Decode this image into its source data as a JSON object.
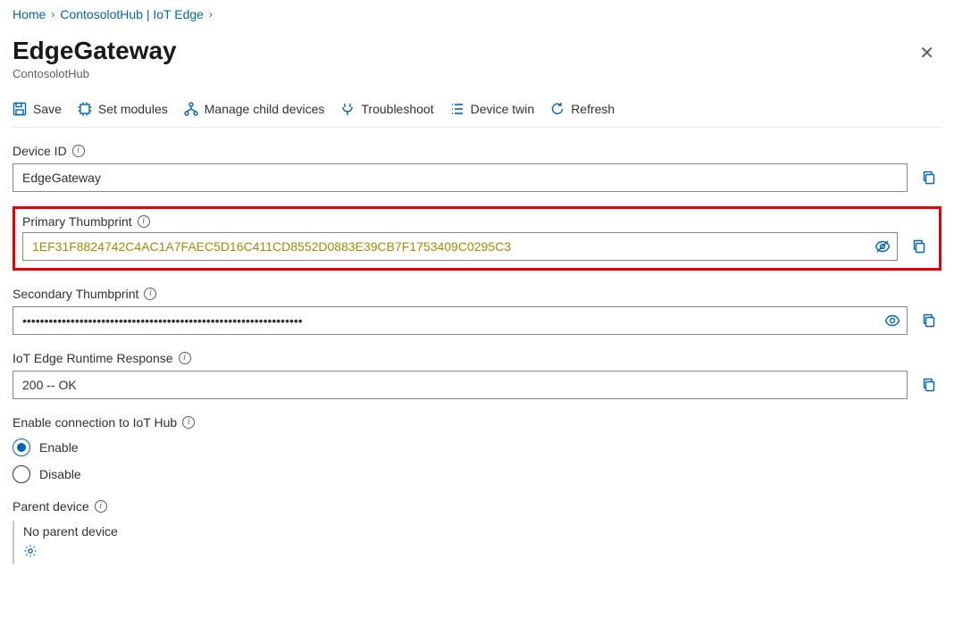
{
  "breadcrumb": {
    "home": "Home",
    "hub": "ContosolotHub | IoT Edge"
  },
  "header": {
    "title": "EdgeGateway",
    "subtitle": "ContosolotHub"
  },
  "toolbar": {
    "save": "Save",
    "set_modules": "Set modules",
    "manage_children": "Manage child devices",
    "troubleshoot": "Troubleshoot",
    "device_twin": "Device twin",
    "refresh": "Refresh"
  },
  "fields": {
    "device_id": {
      "label": "Device ID",
      "value": "EdgeGateway"
    },
    "primary_thumb": {
      "label": "Primary Thumbprint",
      "value": "1EF31F8824742C4AC1A7FAEC5D16C411CD8552D0883E39CB7F1753409C0295C3"
    },
    "secondary_thumb": {
      "label": "Secondary Thumbprint",
      "value": "••••••••••••••••••••••••••••••••••••••••••••••••••••••••••••••••"
    },
    "runtime": {
      "label": "IoT Edge Runtime Response",
      "value": "200 -- OK"
    },
    "enable_conn": {
      "label": "Enable connection to IoT Hub",
      "enable": "Enable",
      "disable": "Disable",
      "selected": "enable"
    },
    "parent": {
      "label": "Parent device",
      "value": "No parent device"
    }
  }
}
